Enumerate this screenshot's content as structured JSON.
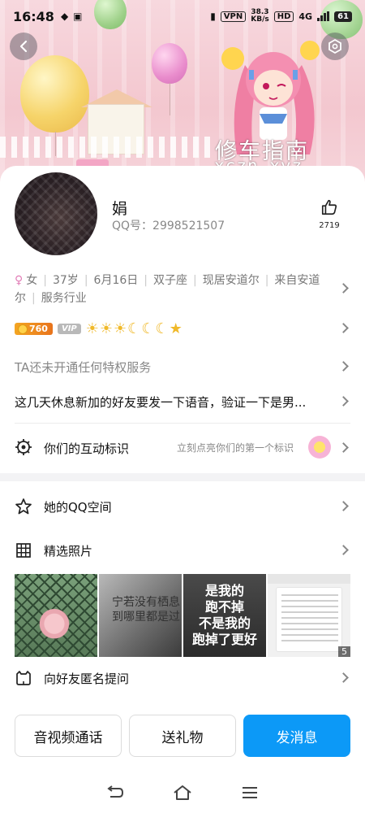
{
  "status_bar": {
    "time": "16:48",
    "vpn": "VPN",
    "net_speed": [
      "38.3",
      "KB/s"
    ],
    "hd": "HD",
    "network": "4G",
    "battery": "61"
  },
  "banner": {
    "watermark_cn": "修车指南",
    "watermark_url": "xczn.xyz"
  },
  "profile": {
    "name": "娟",
    "qq_label": "QQ号：",
    "qq_number": "2998521507",
    "likes": "2719"
  },
  "info": {
    "gender": "女",
    "age": "37岁",
    "birthday": "6月16日",
    "zodiac": "双子座",
    "location": "现居安道尔",
    "hometown": "来自安道尔",
    "industry": "服务行业"
  },
  "badges": {
    "level_points": "760",
    "vip": "VIP",
    "level_icons": "☀☀☀☾☾☾★"
  },
  "privilege_text": "TA还未开通任何特权服务",
  "signature": "这几天休息新加的好友要发一下语音，验证一下是男...",
  "interaction": {
    "label": "你们的互动标识",
    "hint": "立刻点亮你们的第一个标识"
  },
  "qzone_label": "她的QQ空间",
  "photos": {
    "label": "精选照片",
    "p2_text": [
      "宁若没有栖息",
      "到哪里都是过"
    ],
    "p3_text": [
      "是我的",
      "跑不掉",
      "不是我的",
      "跑掉了更好"
    ],
    "count": "5"
  },
  "anon_label": "向好友匿名提问",
  "buttons": {
    "call": "音视频通话",
    "gift": "送礼物",
    "message": "发消息"
  },
  "colors": {
    "accent": "#0c99f7",
    "banner_pink": "#f3c7cf"
  }
}
